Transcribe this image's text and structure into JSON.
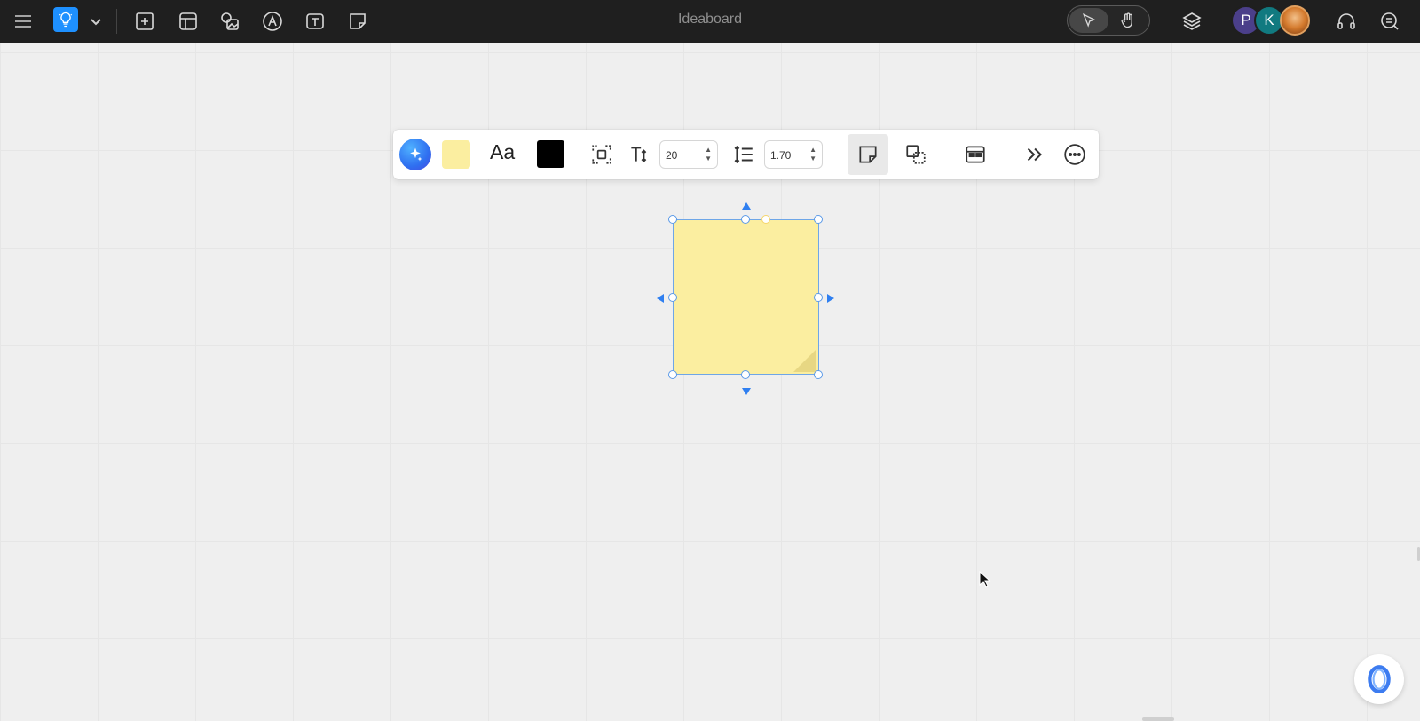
{
  "app": {
    "title": "Ideaboard"
  },
  "topbar": {
    "menu_icon": "hamburger-menu-icon",
    "app_icon": "lightbulb-icon",
    "tools": [
      {
        "name": "add-frame-icon"
      },
      {
        "name": "template-icon"
      },
      {
        "name": "image-search-icon"
      },
      {
        "name": "pen-icon"
      },
      {
        "name": "text-box-icon"
      },
      {
        "name": "sticky-note-icon"
      }
    ],
    "mode": {
      "active": "select"
    },
    "avatars": [
      {
        "initial": "P",
        "color": "#4b3f8a"
      },
      {
        "initial": "K",
        "color": "#117a80"
      },
      {
        "initial": "",
        "color": "#c85a1c"
      }
    ]
  },
  "toolbar": {
    "font_label": "Aa",
    "fill_color": "#fbeea0",
    "text_color": "#000000",
    "font_size": "20",
    "line_height": "1.70"
  },
  "colors": {
    "accent": "#2f7ff0",
    "sticky": "#fbeea0",
    "selection": "#6ea6e8"
  }
}
